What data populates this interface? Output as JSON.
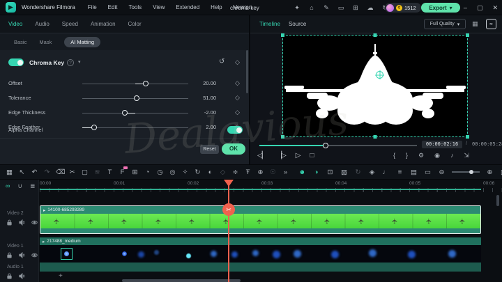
{
  "titlebar": {
    "app_name": "Wondershare Filmora",
    "menus": [
      "File",
      "Edit",
      "Tools",
      "View",
      "Extended",
      "Help",
      "Version"
    ],
    "project_title": "chroma-key",
    "logo_glyph": "▶",
    "action_icons": [
      {
        "name": "gift-icon",
        "glyph": "✦"
      },
      {
        "name": "home-icon",
        "glyph": "⌂"
      },
      {
        "name": "survey-icon",
        "glyph": "✎"
      },
      {
        "name": "device-icon",
        "glyph": "▭"
      },
      {
        "name": "screen-share-icon",
        "glyph": "⊞"
      },
      {
        "name": "cloud-upload-icon",
        "glyph": "☁"
      },
      {
        "name": "sync-icon",
        "glyph": "↻"
      },
      {
        "name": "layout-icon",
        "glyph": "◱"
      }
    ],
    "coin_glyph": "¢",
    "coin_count": "1512",
    "export_label": "Export",
    "export_caret": "▾",
    "window_controls": [
      {
        "name": "minimize-button",
        "glyph": "–"
      },
      {
        "name": "restore-button",
        "glyph": "▢"
      },
      {
        "name": "close-button",
        "glyph": "✕"
      }
    ]
  },
  "left_panel": {
    "tabs": [
      {
        "label": "Video",
        "state": "active"
      },
      {
        "label": "Audio"
      },
      {
        "label": "Speed"
      },
      {
        "label": "Animation"
      },
      {
        "label": "Color"
      }
    ],
    "subtabs": [
      {
        "label": "Basic"
      },
      {
        "label": "Mask"
      },
      {
        "label": "AI Matting",
        "state": "active"
      }
    ],
    "section_title": "Chroma Key",
    "help_glyph": "?",
    "caret_glyph": "▾",
    "reset_icon_glyph": "↺",
    "keyframe_glyph": "◇",
    "params": [
      {
        "label": "Offset",
        "value": "20.00",
        "handle_pct": 60,
        "fill_from_pct": 50
      },
      {
        "label": "Tolerance",
        "value": "51.00",
        "handle_pct": 51,
        "fill_from_pct": 50
      },
      {
        "label": "Edge Thickness",
        "value": "-2.00",
        "handle_pct": 40,
        "fill_from_pct": 50
      },
      {
        "label": "Edge Feather",
        "value": "2.00",
        "handle_pct": 11,
        "fill_from_pct": 0
      }
    ],
    "alpha_channel_label": "Alpha Channel",
    "reset_label": "Reset",
    "ok_label": "OK"
  },
  "preview": {
    "tabs": [
      {
        "label": "Timeline",
        "state": "active"
      },
      {
        "label": "Source"
      }
    ],
    "quality_label": "Full Quality",
    "quality_caret": "▾",
    "grid_icon_glyph": "▦",
    "scope_icon_glyph": "≈",
    "current_time": "00:00:02:16",
    "time_separator": "/",
    "total_time": "00:00:05:28",
    "seek_pct": 42,
    "transport": [
      {
        "name": "prev-frame-button",
        "glyph": "◁▏"
      },
      {
        "name": "next-frame-button",
        "glyph": "▕▷"
      },
      {
        "name": "play-button",
        "glyph": "▷"
      },
      {
        "name": "stop-button",
        "glyph": "□"
      }
    ],
    "tools": [
      {
        "name": "mark-in-icon",
        "glyph": "{"
      },
      {
        "name": "mark-out-icon",
        "glyph": "}"
      },
      {
        "name": "render-settings-icon",
        "glyph": "⚙"
      },
      {
        "name": "snapshot-icon",
        "glyph": "◉"
      },
      {
        "name": "volume-icon",
        "glyph": "♪"
      },
      {
        "name": "fullscreen-icon",
        "glyph": "⇲"
      }
    ]
  },
  "toolbar": {
    "left_icons": [
      {
        "name": "media-grid-icon",
        "glyph": "▦"
      },
      {
        "name": "select-tool-icon",
        "glyph": "↖"
      },
      {
        "name": "undo-icon",
        "glyph": "↶"
      },
      {
        "name": "redo-icon",
        "glyph": "↷",
        "state": "dim"
      },
      {
        "name": "delete-icon",
        "glyph": "⌫"
      },
      {
        "name": "split-icon",
        "glyph": "✂"
      },
      {
        "name": "crop-icon",
        "glyph": "▢"
      },
      {
        "name": "ripple-edit-icon",
        "glyph": "≋",
        "state": "dim"
      },
      {
        "name": "text-tool-icon",
        "glyph": "T"
      },
      {
        "name": "effects-icon",
        "glyph": "F",
        "state": "badge"
      },
      {
        "name": "overlay-icon",
        "glyph": "⊞"
      },
      {
        "name": "speed-icon",
        "glyph": "◔"
      },
      {
        "name": "clock-icon",
        "glyph": "◷"
      },
      {
        "name": "motion-track-icon",
        "glyph": "◎"
      },
      {
        "name": "sparkle-icon",
        "glyph": "✧"
      },
      {
        "name": "render-preview-icon",
        "glyph": "↻"
      },
      {
        "name": "mask-icon",
        "glyph": "◐"
      },
      {
        "name": "keyframe-icon",
        "glyph": "◇",
        "state": "dim"
      },
      {
        "name": "audio-mixer-icon",
        "glyph": "≑"
      },
      {
        "name": "subtitle-icon",
        "glyph": "Ŧ"
      },
      {
        "name": "plugin-icon",
        "glyph": "⊕"
      },
      {
        "name": "person-icon",
        "glyph": "☉",
        "state": "dim"
      },
      {
        "name": "more-tools-icon",
        "glyph": "»"
      }
    ],
    "right_icons": [
      {
        "name": "ai-portrait-icon",
        "glyph": "☻",
        "state": "accent"
      },
      {
        "name": "chroma-key-icon",
        "glyph": "◑",
        "state": "accent"
      },
      {
        "name": "export-frame-icon",
        "glyph": "⊡"
      },
      {
        "name": "image-icon",
        "glyph": "▧"
      },
      {
        "name": "render-icon",
        "glyph": "↻",
        "state": "dim"
      },
      {
        "name": "shield-icon",
        "glyph": "◈"
      },
      {
        "name": "microphone-icon",
        "glyph": "♩"
      },
      {
        "name": "audio-meter-icon",
        "glyph": "≡"
      },
      {
        "name": "film-roll-icon",
        "glyph": "▤"
      },
      {
        "name": "captions-icon",
        "glyph": "▭"
      },
      {
        "name": "zoom-out-icon",
        "glyph": "⊖"
      }
    ],
    "zoom_in_glyph": "⊕",
    "track-height_glyph": "▥",
    "track_height_caret": "▾"
  },
  "timeline": {
    "corner_icons": [
      {
        "name": "link-icon",
        "glyph": "∞",
        "state": "accent"
      },
      {
        "name": "magnet-icon",
        "glyph": "∪"
      },
      {
        "name": "track-manage-icon",
        "glyph": "≣"
      }
    ],
    "ruler_labels": [
      "00:00",
      "00:01",
      "00:02",
      "00:03",
      "00:04",
      "00:05",
      "00:06"
    ],
    "playhead_scissors_glyph": "✂",
    "tracks": [
      {
        "label": "Video 2",
        "icons": [
          "lock-icon",
          "mute-icon",
          "eye-icon"
        ]
      },
      {
        "label": "Video 1",
        "icons": [
          "lock-icon",
          "mute-icon",
          "eye-icon"
        ]
      },
      {
        "label": "Audio 1",
        "icons": [
          "lock-icon",
          "mute-icon"
        ]
      }
    ],
    "clips": [
      {
        "icon": "▸",
        "label": "14100-685293289"
      },
      {
        "icon": "▸",
        "label": "217488_medium"
      }
    ],
    "plane_thumbs": [
      "✈",
      "✈",
      "✈",
      "✈",
      "✈",
      "✈",
      "✈",
      "✈",
      "✈",
      "✈",
      "✈",
      "✈",
      "✈"
    ],
    "add_track_label": "+"
  },
  "watermark_text": "Dealavious",
  "colors": {
    "accent": "#36d6b2",
    "export_button": "#5fe3ab",
    "clip_green": "#58df45",
    "playhead_red": "#f0614e"
  }
}
